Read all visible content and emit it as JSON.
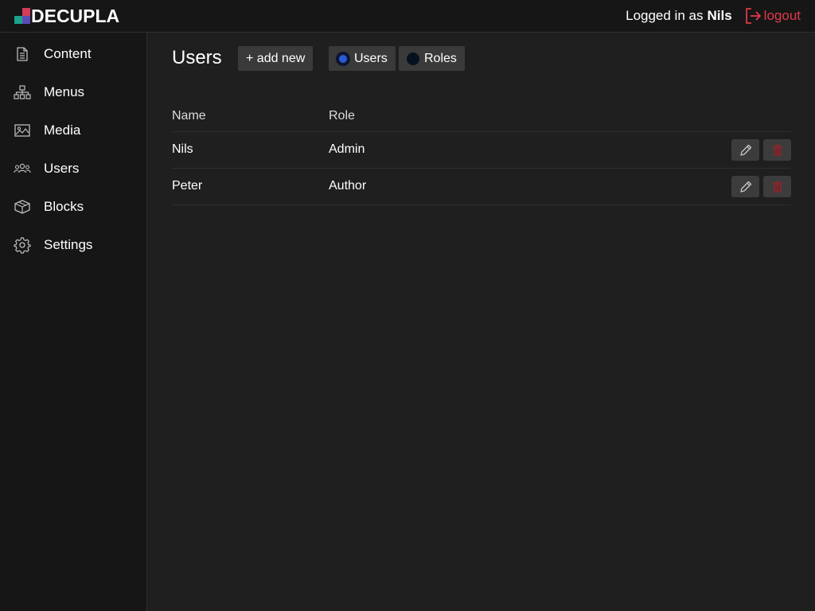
{
  "brand": {
    "name": "DECUPLA",
    "colors": [
      "#1aa38c",
      "#d63b5a",
      "#5c4db3",
      "#3f7fd0"
    ]
  },
  "header": {
    "logged_in_prefix": "Logged in as",
    "user_name": "Nils",
    "logout_label": "logout",
    "logout_icon": "logout-icon",
    "logout_color": "#e0394b"
  },
  "sidebar": {
    "items": [
      {
        "label": "Content",
        "icon": "document-icon"
      },
      {
        "label": "Menus",
        "icon": "sitemap-icon"
      },
      {
        "label": "Media",
        "icon": "image-icon"
      },
      {
        "label": "Users",
        "icon": "users-icon"
      },
      {
        "label": "Blocks",
        "icon": "cube-icon"
      },
      {
        "label": "Settings",
        "icon": "gear-icon"
      }
    ]
  },
  "main": {
    "title": "Users",
    "add_new_label": "+ add new",
    "view_toggle": {
      "options": [
        "Users",
        "Roles"
      ],
      "selected": "Users"
    },
    "table": {
      "columns": [
        "Name",
        "Role"
      ],
      "rows": [
        {
          "name": "Nils",
          "role": "Admin"
        },
        {
          "name": "Peter",
          "role": "Author"
        }
      ],
      "row_actions": [
        "edit-icon",
        "delete-icon"
      ]
    }
  }
}
